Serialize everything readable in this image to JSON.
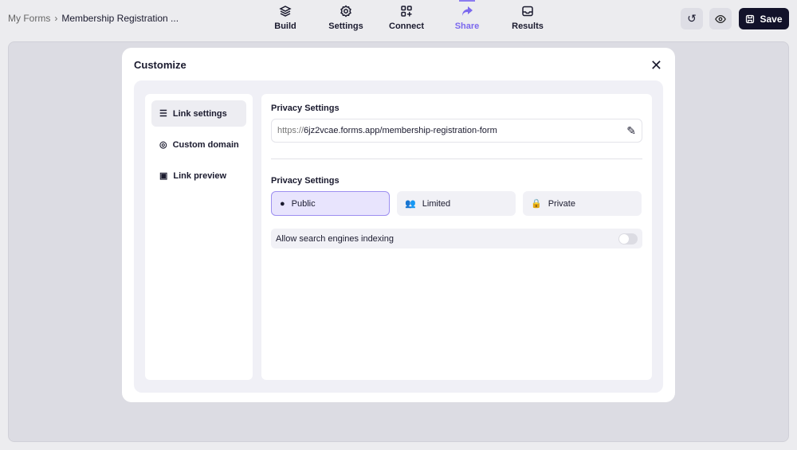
{
  "breadcrumb": {
    "root": "My Forms",
    "separator": "›",
    "current": "Membership Registration ..."
  },
  "nav": [
    {
      "label": "Build",
      "icon": "layers-icon"
    },
    {
      "label": "Settings",
      "icon": "gear-icon"
    },
    {
      "label": "Connect",
      "icon": "apps-add-icon"
    },
    {
      "label": "Share",
      "icon": "share-icon",
      "active": true
    },
    {
      "label": "Results",
      "icon": "inbox-icon"
    }
  ],
  "toolbar": {
    "save_label": "Save"
  },
  "modal": {
    "title": "Customize",
    "sidebar": [
      {
        "label": "Link settings",
        "active": true
      },
      {
        "label": "Custom domain"
      },
      {
        "label": "Link preview"
      }
    ],
    "url_label": "Privacy Settings",
    "url_prefix": "https://",
    "url_rest": "6jz2vcae.forms.app/membership-registration-form",
    "privacy_label": "Privacy Settings",
    "privacy_options": [
      {
        "label": "Public",
        "selected": true
      },
      {
        "label": "Limited"
      },
      {
        "label": "Private"
      }
    ],
    "indexing_label": "Allow search engines indexing",
    "indexing_enabled": false
  },
  "colors": {
    "accent": "#7b68ee",
    "save_bg": "#12122a"
  }
}
